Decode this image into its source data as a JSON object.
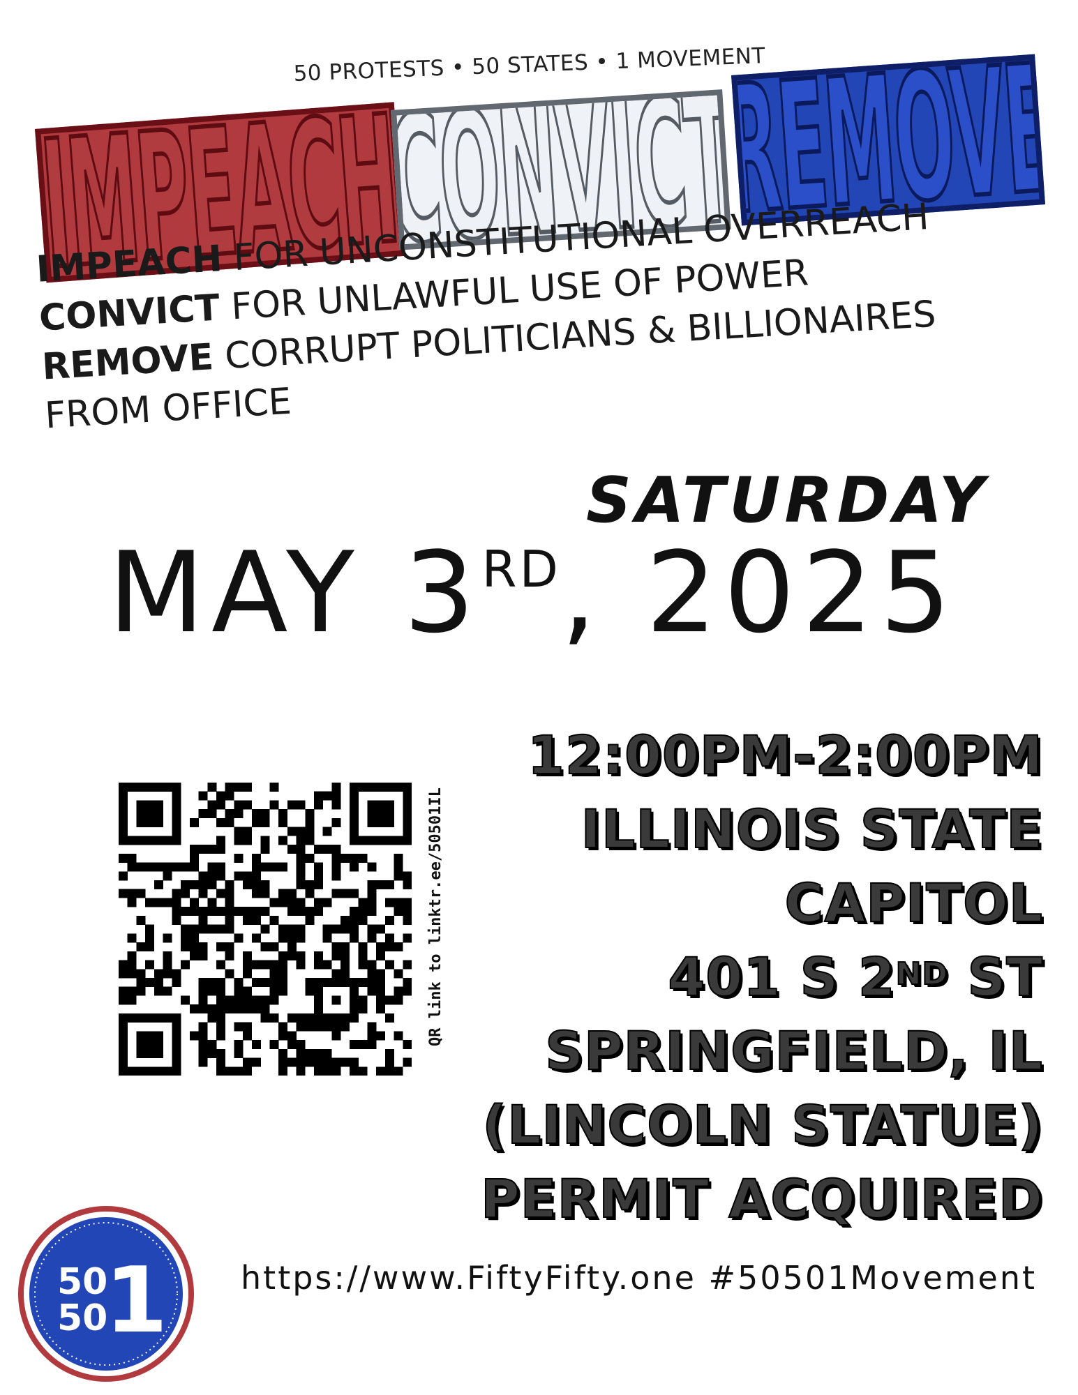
{
  "tagline": "50 PROTESTS • 50 STATES • 1 MOVEMENT",
  "headline": {
    "word1": "IMPEACH",
    "word2": "CONVICT",
    "word3": "REMOVE"
  },
  "reasons": [
    {
      "bold": "IMPEACH",
      "text": " FOR UNCONSTITUTIONAL OVERREACH"
    },
    {
      "bold": "CONVICT",
      "text": " FOR UNLAWFUL USE OF POWER"
    },
    {
      "bold": "REMOVE",
      "text": " CORRUPT POLITICIANS & BILLIONAIRES"
    },
    {
      "bold": "",
      "text": "FROM OFFICE"
    }
  ],
  "date": {
    "weekday": "SATURDAY",
    "month_day": "MAY 3",
    "suffix": "RD",
    "year": ", 2025"
  },
  "details": {
    "time": "12:00PM-2:00PM",
    "venue_line1": "ILLINOIS STATE",
    "venue_line2": "CAPITOL",
    "address_num": "401 S 2",
    "address_suffix": "ND",
    "address_street": " ST",
    "city": "SPRINGFIELD, IL",
    "landmark": "(LINCOLN STATUE)",
    "permit": "PERMIT ACQUIRED"
  },
  "qr": {
    "caption": "QR link to linktr.ee/50501IL"
  },
  "logo": {
    "line1": "50",
    "line2": "50",
    "big": "1",
    "colors": {
      "outer_ring": "#b03a3e",
      "inner": "#2346b6"
    }
  },
  "footer": {
    "text": "https://www.FiftyFifty.one #50501Movement"
  }
}
